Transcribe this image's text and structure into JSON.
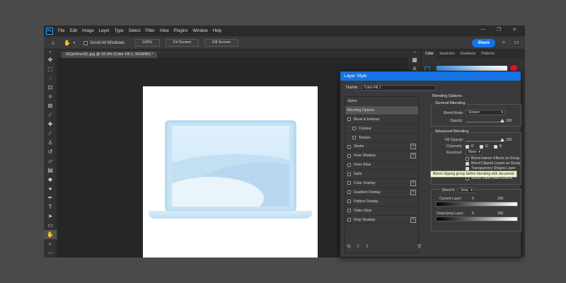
{
  "app": {
    "logo": "Ps",
    "menu": [
      "File",
      "Edit",
      "Image",
      "Layer",
      "Type",
      "Select",
      "Filter",
      "View",
      "Plugins",
      "Window",
      "Help"
    ],
    "window_controls": [
      "—",
      "❐",
      "✕"
    ]
  },
  "options_bar": {
    "scroll_all_windows": "Scroll All Windows",
    "zoom_button": "100%",
    "fit_screen": "Fit Screen",
    "fill_screen": "Fill Screen",
    "share": "Share"
  },
  "document": {
    "tab_title": "61Qz0mvJ2L.jpg @ 33.3% (Color Fill 1, RGB/8#) *"
  },
  "right_panel": {
    "tabs": [
      "Color",
      "Swatches",
      "Gradients",
      "Patterns"
    ],
    "accent_color": "#e8142a"
  },
  "layer_style": {
    "title": "Layer Style",
    "name_label": "Name:",
    "name_value": "Color Fill 1",
    "styles": [
      {
        "label": "Styles",
        "kind": "header"
      },
      {
        "label": "Blending Options",
        "kind": "selected"
      },
      {
        "label": "Bevel & Emboss",
        "kind": "check"
      },
      {
        "label": "Contour",
        "kind": "sub"
      },
      {
        "label": "Texture",
        "kind": "sub"
      },
      {
        "label": "Stroke",
        "kind": "plus"
      },
      {
        "label": "Inner Shadow",
        "kind": "plus"
      },
      {
        "label": "Inner Glow",
        "kind": "check"
      },
      {
        "label": "Satin",
        "kind": "check"
      },
      {
        "label": "Color Overlay",
        "kind": "plus"
      },
      {
        "label": "Gradient Overlay",
        "kind": "plus"
      },
      {
        "label": "Pattern Overlay",
        "kind": "check"
      },
      {
        "label": "Outer Glow",
        "kind": "check"
      },
      {
        "label": "Drop Shadow",
        "kind": "plus"
      }
    ],
    "fx_icons": [
      "fx",
      "⇧",
      "⇩"
    ],
    "trash_icon": "🗑",
    "blending_options": "Blending Options",
    "general_blending": "General Blending",
    "blend_mode_label": "Blend Mode:",
    "blend_mode_value": "Screen",
    "opacity_label": "Opacity:",
    "opacity_value": "100",
    "opacity_level": 1.0,
    "advanced_blending": "Advanced Blending",
    "fill_opacity_label": "Fill Opacity:",
    "fill_opacity_value": "100",
    "channels_label": "Channels:",
    "channels": [
      "R",
      "G",
      "B"
    ],
    "knockout_label": "Knockout:",
    "knockout_value": "None",
    "blend_interior": "Blend Interior Effects as Group",
    "blend_clipped": "Blend Clipped Layers as Group",
    "transparency_shapes": "Transparency Shapes Layer",
    "tooltip": "Blend clipping group before blending with document",
    "vector_mask": "Vector Mask Hides Effects",
    "blend_if_label": "Blend If:",
    "blend_if_value": "Gray",
    "current_layer_label": "Current Layer:",
    "current_layer_min": "0",
    "current_layer_max": "255",
    "underlying_layer_label": "Underlying Layer:",
    "underlying_layer_min": "0",
    "underlying_layer_max": "255"
  }
}
